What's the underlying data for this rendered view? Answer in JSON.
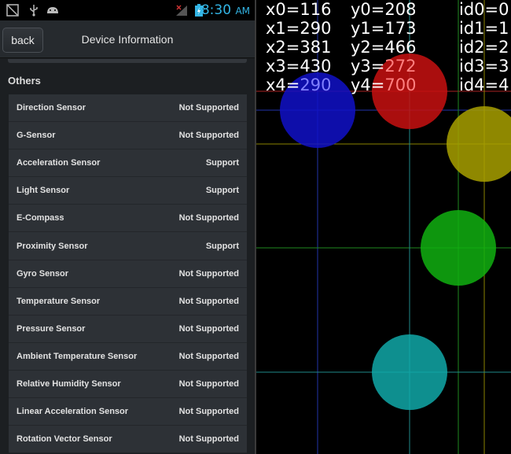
{
  "status_bar": {
    "time": "8:30",
    "ampm": "AM",
    "icons": [
      "screenshot-icon",
      "usb-icon",
      "android-icon",
      "no-signal-icon",
      "battery-charging-icon"
    ]
  },
  "title_bar": {
    "back_label": "back",
    "title": "Device Information"
  },
  "section": {
    "title": "Others",
    "rows": [
      {
        "label": "Direction Sensor",
        "value": "Not Supported"
      },
      {
        "label": "G-Sensor",
        "value": "Not Supported"
      },
      {
        "label": "Acceleration Sensor",
        "value": "Support"
      },
      {
        "label": "Light Sensor",
        "value": "Support"
      },
      {
        "label": "E-Compass",
        "value": "Not Supported"
      },
      {
        "label": "Proximity Sensor",
        "value": "Support"
      },
      {
        "label": "Gyro Sensor",
        "value": "Not Supported"
      },
      {
        "label": "Temperature Sensor",
        "value": "Not Supported"
      },
      {
        "label": "Pressure Sensor",
        "value": "Not Supported"
      },
      {
        "label": "Ambient Temperature Sensor",
        "value": "Not Supported"
      },
      {
        "label": "Relative Humidity Sensor",
        "value": "Not Supported"
      },
      {
        "label": "Linear Acceleration Sensor",
        "value": "Not Supported"
      },
      {
        "label": "Rotation Vector Sensor",
        "value": "Not Supported"
      }
    ]
  },
  "touch_test": {
    "readouts": [
      {
        "x_label": "x0=",
        "x": "116",
        "y_label": "y0=",
        "y": "208",
        "id_label": "id0=",
        "id": "0"
      },
      {
        "x_label": "x1=",
        "x": "290",
        "y_label": "y1=",
        "y": "173",
        "id_label": "id1=",
        "id": "1"
      },
      {
        "x_label": "x2=",
        "x": "381",
        "y_label": "y2=",
        "y": "466",
        "id_label": "id2=",
        "id": "2"
      },
      {
        "x_label": "x3=",
        "x": "430",
        "y_label": "y3=",
        "y": "272",
        "id_label": "id3=",
        "id": "3"
      },
      {
        "x_label": "x4=",
        "x": "290",
        "y_label": "y4=",
        "y": "700",
        "id_label": "id4=",
        "id": "4"
      }
    ],
    "touch_colors": [
      "#1010c8",
      "#c81010",
      "#a8a000",
      "#10b010",
      "#10a8a8"
    ],
    "highlight_colors": {
      "x4": "#8080ff",
      "y3": "#ff8080",
      "y4": "#ff8080"
    }
  }
}
